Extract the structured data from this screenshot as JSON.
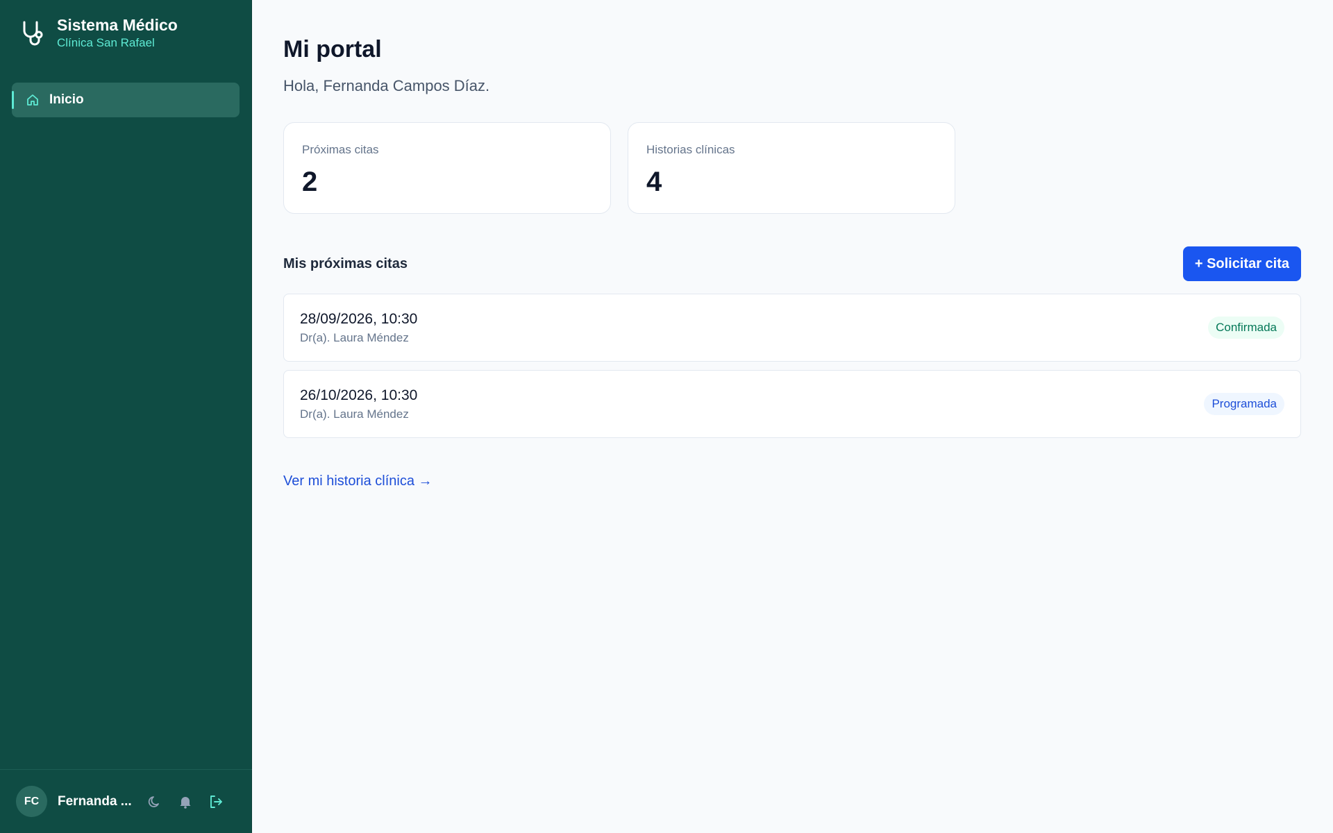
{
  "brand": {
    "title": "Sistema Médico",
    "subtitle": "Clínica San Rafael",
    "icon": "stethoscope-icon"
  },
  "sidebar": {
    "items": [
      {
        "label": "Inicio",
        "icon": "home-icon",
        "active": true
      }
    ]
  },
  "user": {
    "initials": "FC",
    "name": "Fernanda ..."
  },
  "footer_icons": [
    "moon-icon",
    "bell-icon",
    "logout-icon"
  ],
  "page": {
    "title": "Mi portal",
    "greeting": "Hola, Fernanda Campos Díaz."
  },
  "stats": [
    {
      "label": "Próximas citas",
      "value": "2"
    },
    {
      "label": "Historias clínicas",
      "value": "4"
    }
  ],
  "appointments_section": {
    "title": "Mis próximas citas",
    "request_button": "+ Solicitar cita"
  },
  "appointments": [
    {
      "datetime": "28/09/2026, 10:30",
      "doctor": "Dr(a). Laura Méndez",
      "status": "Confirmada"
    },
    {
      "datetime": "26/10/2026, 10:30",
      "doctor": "Dr(a). Laura Méndez",
      "status": "Programada"
    }
  ],
  "history_link": "Ver mi historia clínica →",
  "colors": {
    "sidebar_bg": "#0f4c44",
    "accent_teal": "#5eead4",
    "primary_blue": "#1a56f0",
    "confirmed_green": "#047857",
    "scheduled_blue": "#1d4ed8"
  }
}
